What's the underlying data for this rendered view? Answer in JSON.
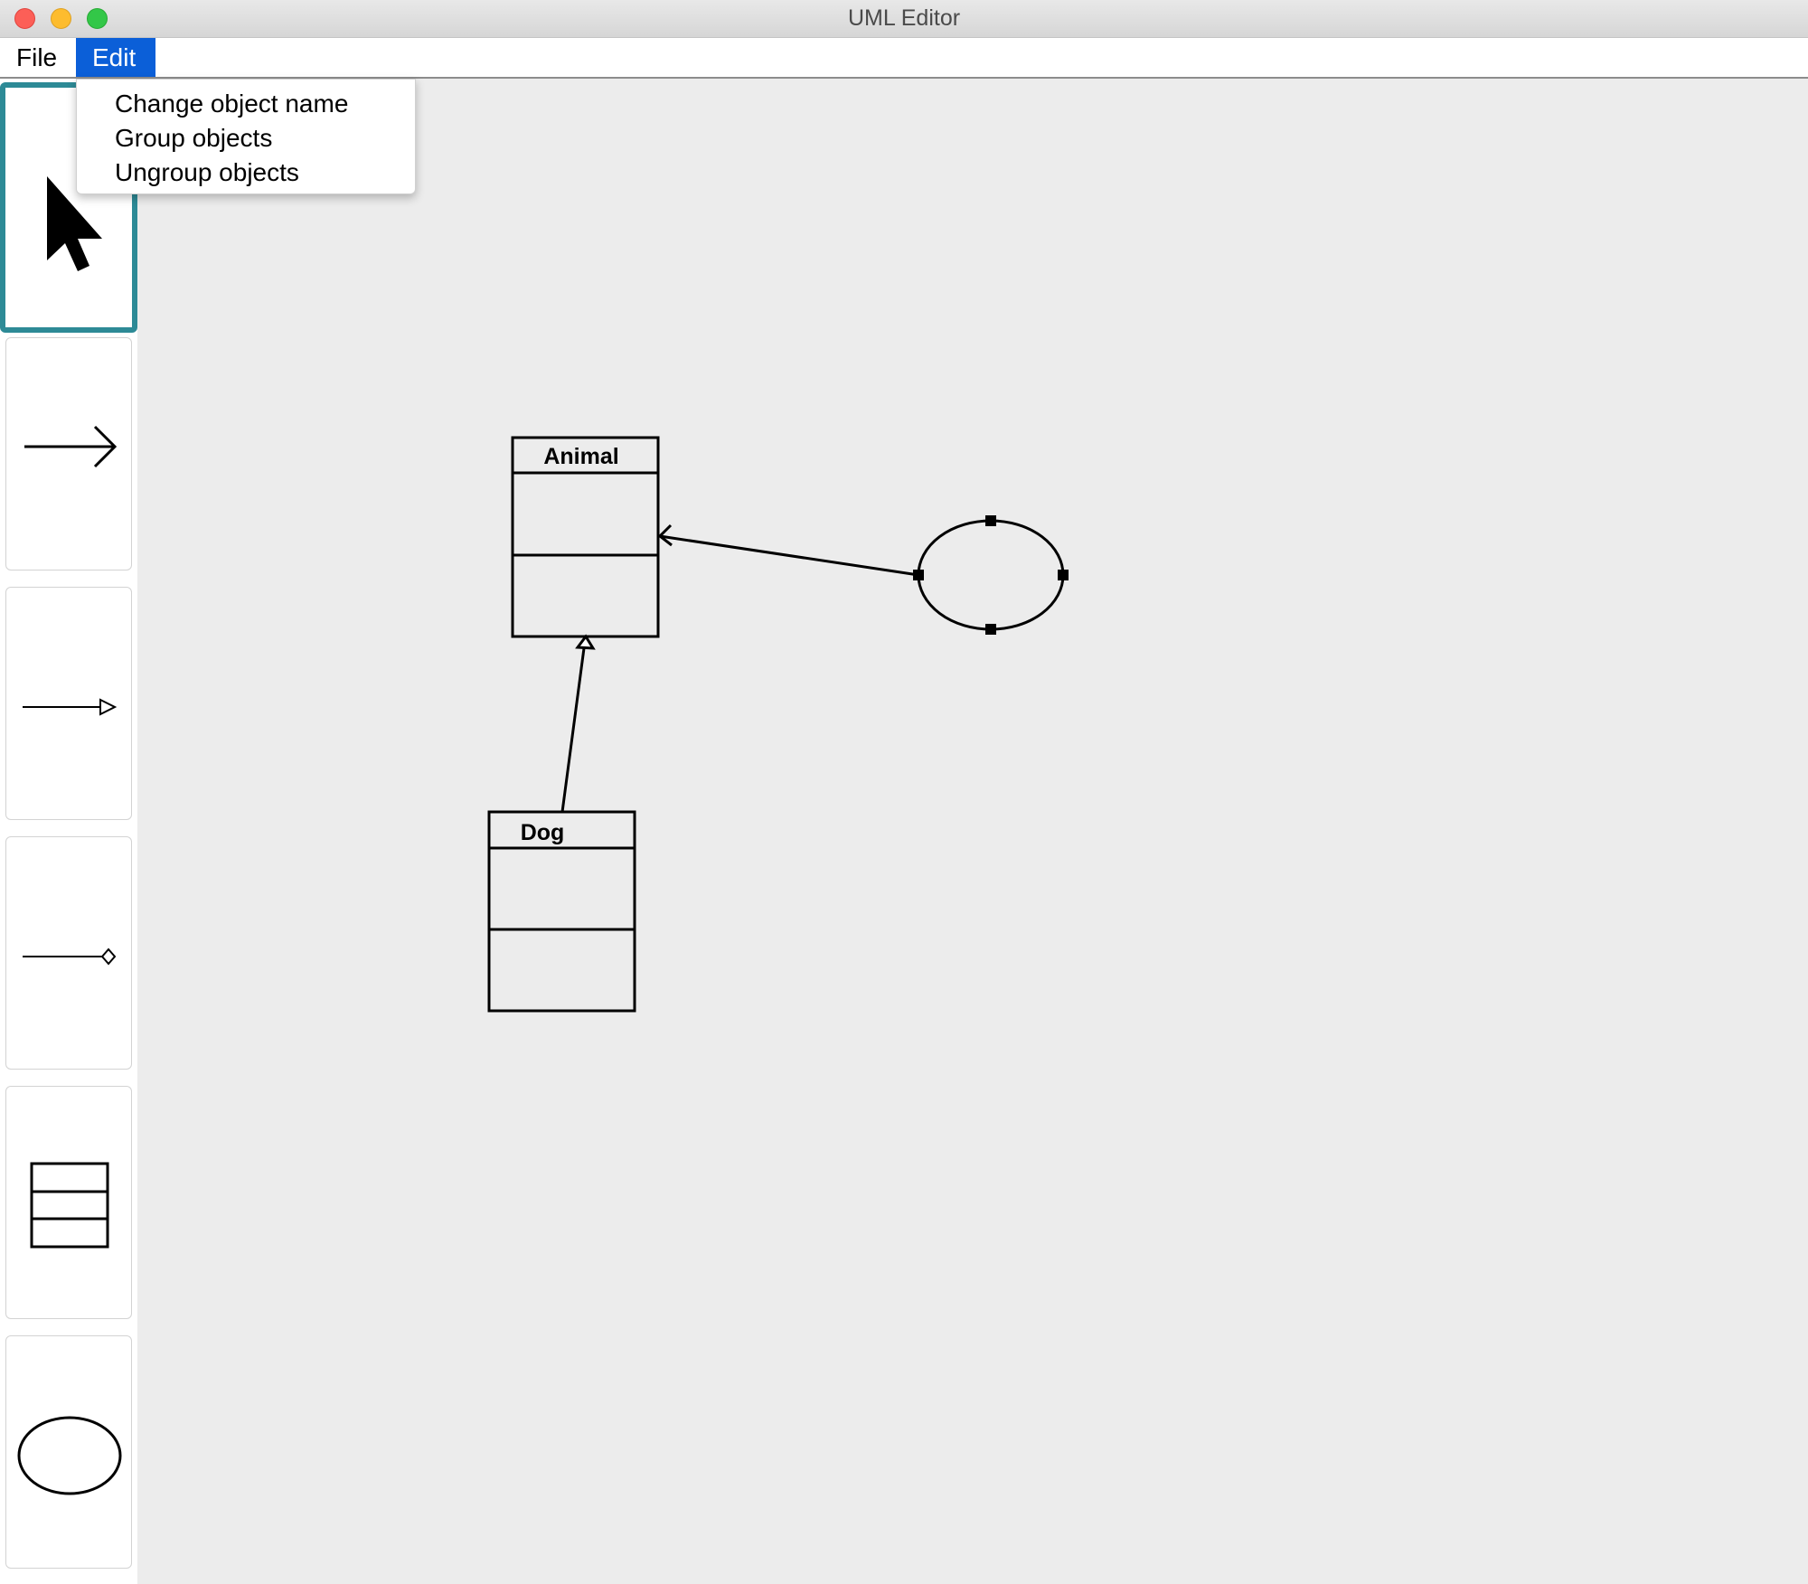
{
  "window": {
    "title": "UML Editor"
  },
  "menubar": {
    "items": [
      {
        "label": "File"
      },
      {
        "label": "Edit",
        "active": true
      }
    ]
  },
  "edit_menu": {
    "items": [
      {
        "label": "Change object name"
      },
      {
        "label": "Group objects"
      },
      {
        "label": "Ungroup objects"
      }
    ]
  },
  "toolbar": {
    "tools": [
      {
        "name": "select",
        "icon": "cursor-icon",
        "selected": true
      },
      {
        "name": "association-line",
        "icon": "arrow-icon",
        "selected": false
      },
      {
        "name": "generalization-line",
        "icon": "hollow-triangle-arrow-icon",
        "selected": false
      },
      {
        "name": "composition-line",
        "icon": "diamond-arrow-icon",
        "selected": false
      },
      {
        "name": "class",
        "icon": "class-box-icon",
        "selected": false
      },
      {
        "name": "use-case",
        "icon": "ellipse-icon",
        "selected": false
      }
    ],
    "selected_color": "#2d8a96"
  },
  "diagram": {
    "classes": [
      {
        "name": "Animal"
      },
      {
        "name": "Dog"
      }
    ],
    "use_cases": [
      {
        "name": ""
      }
    ],
    "connections": [
      {
        "from": "use-case",
        "to": "Animal",
        "type": "association"
      },
      {
        "from": "Dog",
        "to": "Animal",
        "type": "generalization"
      }
    ]
  },
  "colors": {
    "menu_highlight": "#0b5fd8",
    "canvas_bg": "#ececec"
  }
}
